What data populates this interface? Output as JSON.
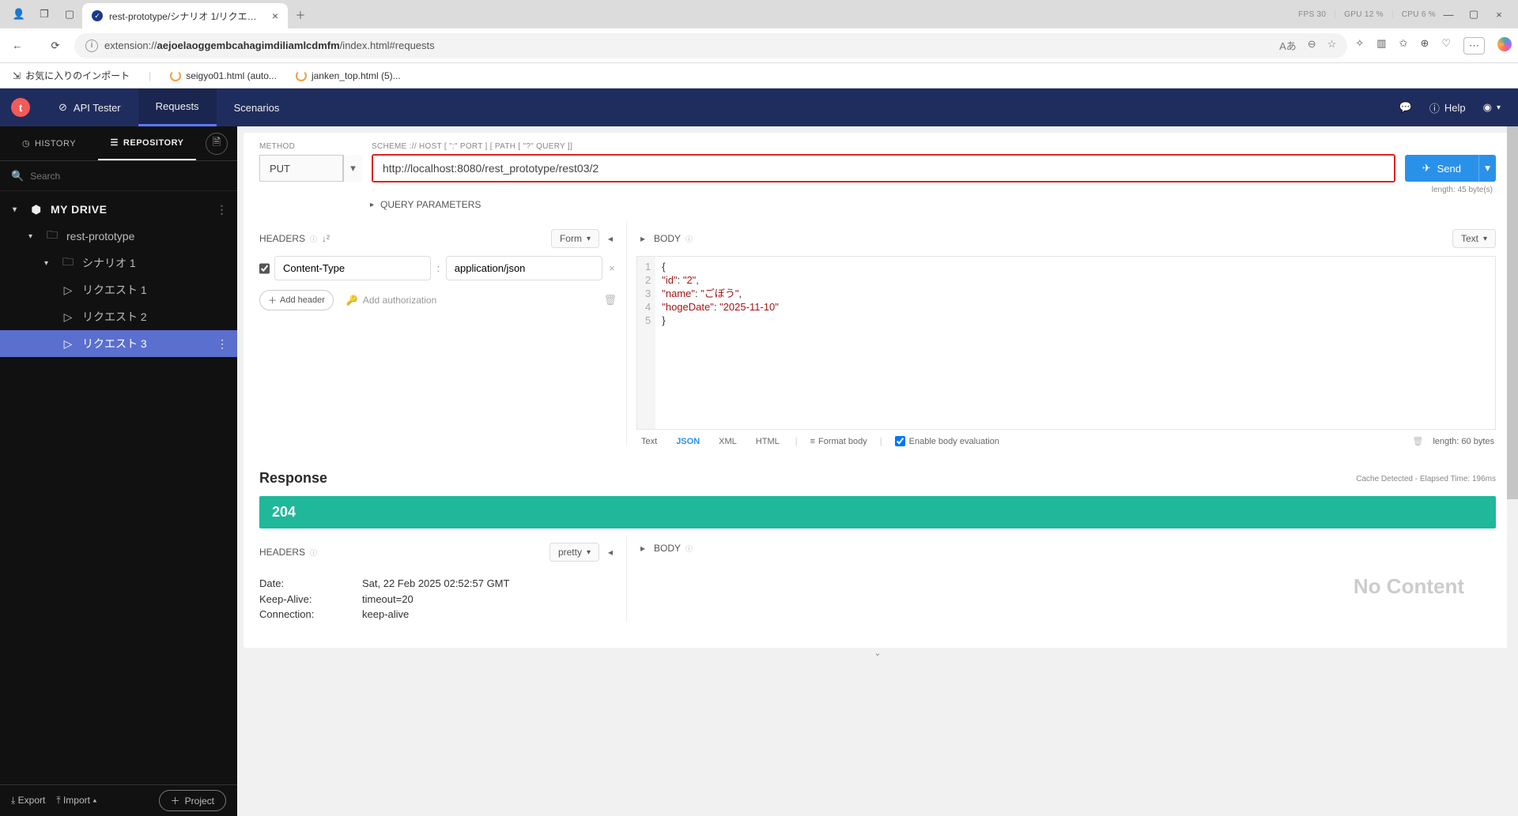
{
  "browser": {
    "tab_title": "rest-prototype/シナリオ 1/リクエスト",
    "url_display_pre": "extension://",
    "url_display_host": "aejoelaoggembcahagimdiliamlcdmfm",
    "url_display_post": "/index.html#requests",
    "stats": {
      "fps_label": "FPS",
      "fps": "30",
      "gpu_label": "GPU",
      "gpu": "12 %",
      "cpu_label": "CPU",
      "cpu": "6 %"
    }
  },
  "bookmarks": {
    "import": "お気に入りのインポート",
    "item1": "seigyo01.html (auto...",
    "item2": "janken_top.html (5)..."
  },
  "app": {
    "logo": "t",
    "title": "API Tester",
    "nav_requests": "Requests",
    "nav_scenarios": "Scenarios",
    "help": "Help"
  },
  "sidebar": {
    "tab_history": "HISTORY",
    "tab_repository": "REPOSITORY",
    "search_placeholder": "Search",
    "drive": "MY DRIVE",
    "project": "rest-prototype",
    "scenario": "シナリオ 1",
    "req1": "リクエスト 1",
    "req2": "リクエスト 2",
    "req3": "リクエスト 3",
    "export": "Export",
    "import": "Import",
    "project_btn": "Project"
  },
  "request": {
    "method_label": "METHOD",
    "scheme_label": "SCHEME :// HOST [ \":\" PORT ] [ PATH [ \"?\" QUERY ]]",
    "method": "PUT",
    "url": "http://localhost:8080/rest_prototype/rest03/2",
    "send": "Send",
    "length_info": "length: 45 byte(s)",
    "query_params": "QUERY PARAMETERS",
    "headers_label": "HEADERS",
    "form_label": "Form",
    "header_name": "Content-Type",
    "header_value": "application/json",
    "add_header": "Add header",
    "add_auth": "Add authorization",
    "body_label": "BODY",
    "body_text_label": "Text",
    "body_lines": [
      "{",
      "\"id\": \"2\",",
      "\"name\": \"ごぼう\",",
      "\"hogeDate\": \"2025-11-10\"",
      "}"
    ],
    "body_modes": {
      "text": "Text",
      "json": "JSON",
      "xml": "XML",
      "html": "HTML"
    },
    "format_body": "Format body",
    "enable_eval": "Enable body evaluation",
    "body_length": "length: 60 bytes"
  },
  "response": {
    "title": "Response",
    "meta": "Cache Detected - Elapsed Time: 196ms",
    "status": "204",
    "headers_label": "HEADERS",
    "pretty": "pretty",
    "body_label": "BODY",
    "no_content": "No Content",
    "headers": [
      {
        "k": "Date:",
        "v": "Sat, 22 Feb 2025 02:52:57 GMT"
      },
      {
        "k": "Keep-Alive:",
        "v": "timeout=20"
      },
      {
        "k": "Connection:",
        "v": "keep-alive"
      }
    ]
  }
}
